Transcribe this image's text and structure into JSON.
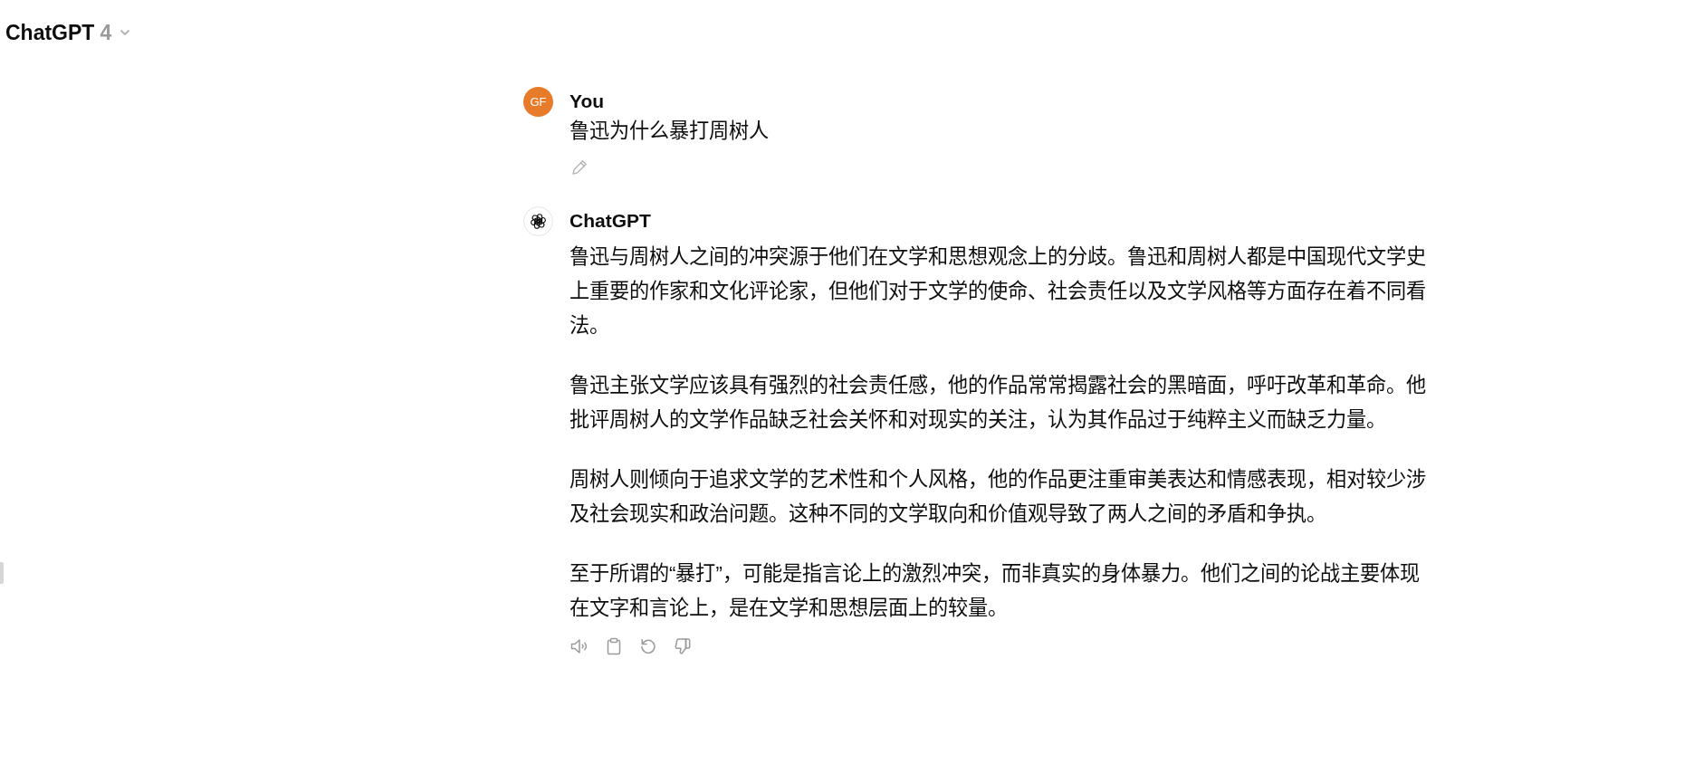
{
  "header": {
    "title": "ChatGPT",
    "model": "4"
  },
  "messages": [
    {
      "kind": "user",
      "author": "You",
      "initials": "GF",
      "paragraphs": [
        "鲁迅为什么暴打周树人"
      ]
    },
    {
      "kind": "assistant",
      "author": "ChatGPT",
      "paragraphs": [
        "鲁迅与周树人之间的冲突源于他们在文学和思想观念上的分歧。鲁迅和周树人都是中国现代文学史上重要的作家和文化评论家，但他们对于文学的使命、社会责任以及文学风格等方面存在着不同看法。",
        "鲁迅主张文学应该具有强烈的社会责任感，他的作品常常揭露社会的黑暗面，呼吁改革和革命。他批评周树人的文学作品缺乏社会关怀和对现实的关注，认为其作品过于纯粹主义而缺乏力量。",
        "周树人则倾向于追求文学的艺术性和个人风格，他的作品更注重审美表达和情感表现，相对较少涉及社会现实和政治问题。这种不同的文学取向和价值观导致了两人之间的矛盾和争执。",
        "至于所谓的“暴打”，可能是指言论上的激烈冲突，而非真实的身体暴力。他们之间的论战主要体现在文字和言论上，是在文学和思想层面上的较量。"
      ]
    }
  ]
}
